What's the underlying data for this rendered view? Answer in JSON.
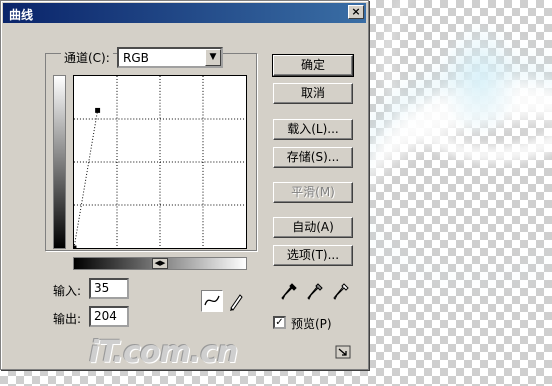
{
  "dialog": {
    "title": "曲线",
    "close_symbol": "×"
  },
  "channel": {
    "label": "通道(C):",
    "selected": "RGB"
  },
  "fields": {
    "input_label": "输入:",
    "input_value": "35",
    "output_label": "输出:",
    "output_value": "204"
  },
  "buttons": {
    "ok": "确定",
    "cancel": "取消",
    "load": "载入(L)...",
    "save": "存储(S)...",
    "smooth": "平滑(M)",
    "auto": "自动(A)",
    "options": "选项(T)..."
  },
  "preview": {
    "label": "预览(P)",
    "checked": true
  },
  "curve": {
    "points": [
      [
        0,
        0
      ],
      [
        35,
        204
      ]
    ],
    "range": [
      0,
      255
    ]
  },
  "tools": [
    "curve-point-tool-icon",
    "pencil-tool-icon",
    "black-eyedropper-icon",
    "gray-eyedropper-icon",
    "white-eyedropper-icon",
    "resize-grip-icon"
  ],
  "watermark": "iT.com.cn",
  "colors": {
    "dialog_bg": "#d4d0c8",
    "titlebar_start": "#0a246a",
    "titlebar_end": "#3a6ea5"
  }
}
